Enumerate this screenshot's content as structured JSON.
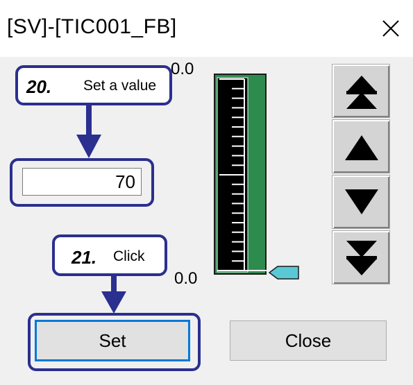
{
  "window": {
    "title": "[SV]-[TIC001_FB]"
  },
  "value_input": {
    "value": "70"
  },
  "scale": {
    "top_label": "0.0",
    "bottom_label": "0.0",
    "indicator_level": 0.0
  },
  "arrow_buttons": [
    {
      "icon": "double-up-arrow-icon"
    },
    {
      "icon": "up-arrow-icon"
    },
    {
      "icon": "down-arrow-icon"
    },
    {
      "icon": "double-down-arrow-icon"
    }
  ],
  "buttons": {
    "set_label": "Set",
    "close_label": "Close"
  },
  "callouts": {
    "step20": {
      "number": "20.",
      "text": "Set a value"
    },
    "step21": {
      "number": "21.",
      "text": "Click"
    }
  },
  "colors": {
    "callout_border": "#2b2f8f",
    "gauge_green": "#2e8b4e",
    "gauge_black": "#000000",
    "indicator_cyan": "#5bc8d6",
    "focus_blue": "#0078d7"
  }
}
